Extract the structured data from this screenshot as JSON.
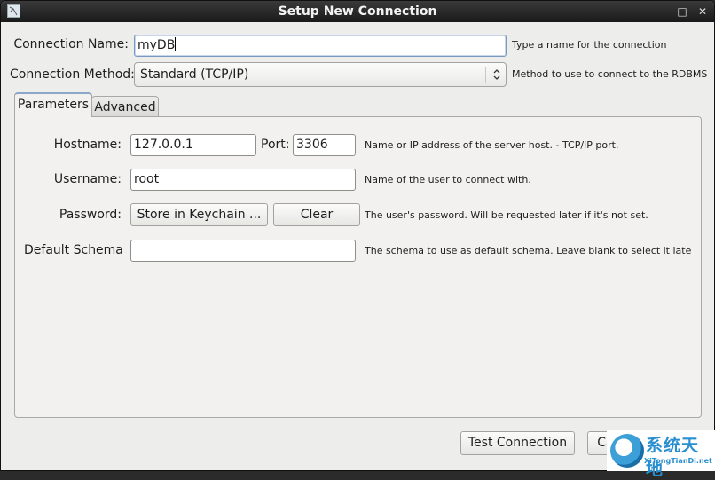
{
  "window": {
    "title": "Setup New Connection",
    "controls": {
      "minimize": "–",
      "maximize": "□",
      "close": "✕"
    }
  },
  "form": {
    "connection_name": {
      "label": "Connection Name:",
      "value": "myDB",
      "hint": "Type a name for the connection"
    },
    "connection_method": {
      "label": "Connection Method:",
      "value": "Standard (TCP/IP)",
      "arrows_icon": "⌃⌄",
      "hint": "Method to use to connect to the RDBMS"
    }
  },
  "tabs": [
    {
      "label": "Parameters",
      "active": true
    },
    {
      "label": "Advanced",
      "active": false
    }
  ],
  "parameters": {
    "hostname": {
      "label": "Hostname:",
      "value": "127.0.0.1"
    },
    "port": {
      "label": "Port:",
      "value": "3306"
    },
    "hostname_hint": "Name or IP address of the server host. - TCP/IP port.",
    "username": {
      "label": "Username:",
      "value": "root",
      "hint": "Name of the user to connect with."
    },
    "password": {
      "label": "Password:",
      "store_button": "Store in Keychain ...",
      "clear_button": "Clear",
      "hint": "The user's password. Will be requested later if it's not set."
    },
    "default_schema": {
      "label": "Default Schema",
      "value": "",
      "hint": "The schema to use as default schema. Leave blank to select it late"
    }
  },
  "footer": {
    "test_connection": "Test Connection",
    "cancel": "Cancel",
    "ok": ""
  },
  "watermark": {
    "cn": "系统天地",
    "en": "XiTongTianDi.net"
  }
}
